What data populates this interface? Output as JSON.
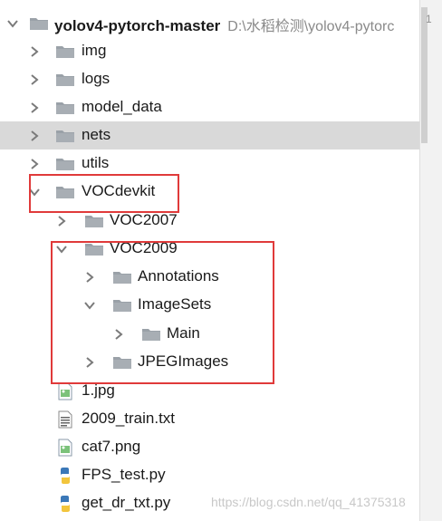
{
  "project": {
    "name": "yolov4-pytorch-master",
    "path": "D:\\水稻检测\\yolov4-pytorc"
  },
  "folders_top": [
    {
      "label": "img"
    },
    {
      "label": "logs"
    },
    {
      "label": "model_data"
    },
    {
      "label": "nets"
    },
    {
      "label": "utils"
    }
  ],
  "vocdevkit": {
    "label": "VOCdevkit",
    "voc2007": "VOC2007",
    "voc2009": "VOC2009",
    "annotations": "Annotations",
    "imagesets": "ImageSets",
    "main": "Main",
    "jpegimages": "JPEGImages"
  },
  "files": [
    {
      "label": "1.jpg",
      "type": "image"
    },
    {
      "label": "2009_train.txt",
      "type": "text"
    },
    {
      "label": "cat7.png",
      "type": "image"
    },
    {
      "label": "FPS_test.py",
      "type": "python"
    },
    {
      "label": "get_dr_txt.py",
      "type": "python"
    }
  ],
  "editor": {
    "line_number": "1"
  },
  "watermark": "https://blog.csdn.net/qq_41375318",
  "colors": {
    "folder": "#9aa1a8",
    "selection": "#d9d9d9",
    "highlight_box": "#e03a3a",
    "arrow": "#7a7a7a"
  }
}
